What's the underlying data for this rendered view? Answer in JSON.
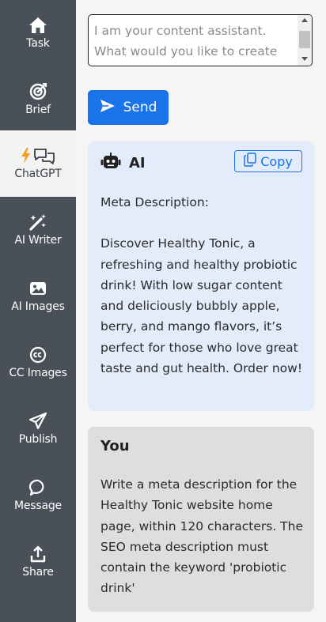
{
  "sidebar": {
    "items": [
      {
        "label": "Task",
        "icon": "home-icon"
      },
      {
        "label": "Brief",
        "icon": "target-icon"
      },
      {
        "label": "ChatGPT",
        "icon": "chat-bolt-icon",
        "active": true
      },
      {
        "label": "AI Writer",
        "icon": "magic-wand-icon"
      },
      {
        "label": "AI Images",
        "icon": "image-icon"
      },
      {
        "label": "CC Images",
        "icon": "creative-commons-icon"
      },
      {
        "label": "Publish",
        "icon": "paper-plane-icon"
      },
      {
        "label": "Message",
        "icon": "speech-bubble-icon"
      },
      {
        "label": "Share",
        "icon": "upload-icon"
      }
    ]
  },
  "prompt": {
    "placeholder": "I am your content assistant. What would you like to create"
  },
  "send_button": {
    "label": "Send"
  },
  "ai_message": {
    "title": "AI",
    "copy_label": "Copy",
    "heading": "Meta Description:",
    "text": "Discover Healthy Tonic, a refreshing and healthy probiotic drink! With low sugar content and deliciously bubbly apple, berry, and mango flavors, it’s perfect for those who love great taste and gut health. Order now!"
  },
  "user_message": {
    "title": "You",
    "text": "Write a meta description for the Healthy Tonic website home page, within 120 characters. The SEO meta description must contain the keyword 'probiotic drink'"
  },
  "colors": {
    "sidebar_bg": "#4a5058",
    "accent": "#1a73e8",
    "ai_card_bg": "#e3ecfb",
    "user_card_bg": "#dedede",
    "bolt": "#f0a020"
  }
}
